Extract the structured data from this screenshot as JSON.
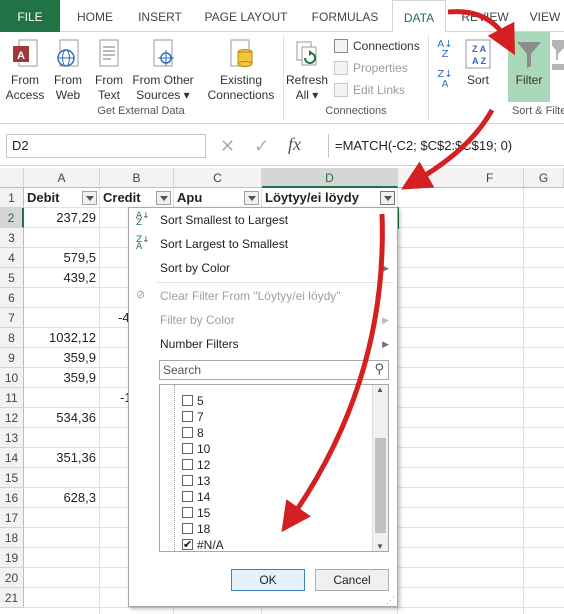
{
  "tabs": [
    "FILE",
    "HOME",
    "INSERT",
    "PAGE LAYOUT",
    "FORMULAS",
    "DATA",
    "REVIEW",
    "VIEW"
  ],
  "active_tab": "DATA",
  "ribbon": {
    "get_external": {
      "from_access": "From\nAccess",
      "from_web": "From\nWeb",
      "from_text": "From\nText",
      "from_other": "From Other\nSources ▾",
      "existing": "Existing\nConnections",
      "label": "Get External Data"
    },
    "connections": {
      "refresh": "Refresh\nAll ▾",
      "connections": "Connections",
      "properties": "Properties",
      "edit_links": "Edit Links",
      "label": "Connections"
    },
    "sort_filter": {
      "sort": "Sort",
      "filter": "Filter",
      "label": "Sort & Filter"
    }
  },
  "formula_bar": {
    "name_box": "D2",
    "formula": "=MATCH(-C2; $C$2:$C$19; 0)"
  },
  "columns": [
    "A",
    "B",
    "C",
    "D",
    "F",
    "G"
  ],
  "headers": {
    "a": "Debit",
    "b": "Credit",
    "c": "Apu",
    "d": "Löytyy/ei löydy"
  },
  "rows": [
    "1",
    "2",
    "3",
    "4",
    "5",
    "6",
    "7",
    "8",
    "9",
    "10",
    "11",
    "12",
    "13",
    "14",
    "15",
    "16",
    "17",
    "18",
    "19",
    "20",
    "21"
  ],
  "debit_values": {
    "r2": "237,29",
    "r4": "579,5",
    "r5": "439,2",
    "r8": "1032,12",
    "r9": "359,9",
    "r10": "359,9",
    "r12": "534,36",
    "r14": "351,36",
    "r16": "628,3"
  },
  "credit_partial": {
    "r7": "-4",
    "r11": "-1"
  },
  "filter_menu": {
    "sort_asc": "Sort Smallest to Largest",
    "sort_desc": "Sort Largest to Smallest",
    "sort_color": "Sort by Color",
    "clear_filter": "Clear Filter From \"Löytyy/ei löydy\"",
    "filter_color": "Filter by Color",
    "number_filters": "Number Filters",
    "search_placeholder": "Search",
    "items": [
      {
        "label": "5",
        "checked": false
      },
      {
        "label": "7",
        "checked": false
      },
      {
        "label": "8",
        "checked": false
      },
      {
        "label": "10",
        "checked": false
      },
      {
        "label": "12",
        "checked": false
      },
      {
        "label": "13",
        "checked": false
      },
      {
        "label": "14",
        "checked": false
      },
      {
        "label": "15",
        "checked": false
      },
      {
        "label": "18",
        "checked": false
      },
      {
        "label": "#N/A",
        "checked": true
      }
    ],
    "ok": "OK",
    "cancel": "Cancel"
  },
  "colors": {
    "excel_green": "#217346",
    "arrow_red": "#d42020",
    "filter_highlight": "#a9d9b8"
  }
}
